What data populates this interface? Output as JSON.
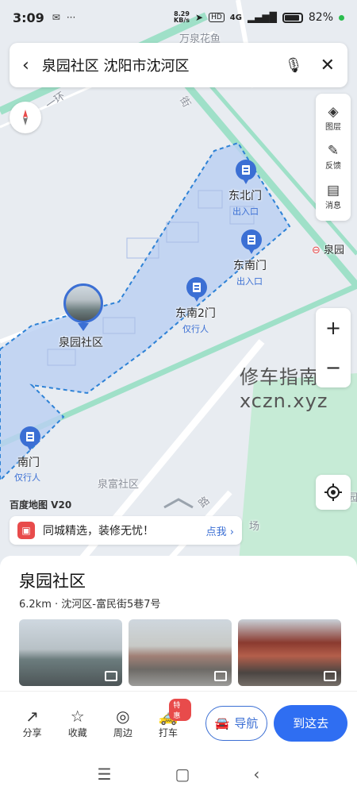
{
  "status_bar": {
    "time": "3:09",
    "net_speed_value": "8.29",
    "net_speed_unit": "KB/s",
    "signal": "4G",
    "battery_percent": "82%",
    "battery_level": 0.82
  },
  "search": {
    "query": "泉园社区 沈阳市沈河区"
  },
  "side_tools": [
    {
      "label": "图层",
      "icon": "layers-icon"
    },
    {
      "label": "反馈",
      "icon": "feedback-icon"
    },
    {
      "label": "消息",
      "icon": "message-icon"
    }
  ],
  "zoom": {
    "in": "+",
    "out": "−"
  },
  "map_labels": {
    "top_poi": "万泉花鱼",
    "road_ring": "一环",
    "road_jie": "街",
    "gate_ne": "东北门",
    "gate_ne_sub": "出入口",
    "gate_se": "东南门",
    "gate_se_sub": "出入口",
    "gate_se2": "东南2门",
    "gate_se2_sub": "仅行人",
    "community": "泉园社区",
    "gate_s": "南门",
    "gate_s_sub": "仅行人",
    "quanfu": "泉富社区",
    "quanyuan_station": "泉园",
    "road_lu": "路",
    "plaza": "场",
    "edge_char": "园"
  },
  "watermark": {
    "line1": "修车指南",
    "line2": "xczn.xyz"
  },
  "brand": "百度地图 V20",
  "promo": {
    "text": "同城精选，装修无忧！",
    "action": "点我 ›"
  },
  "place": {
    "name": "泉园社区",
    "distance": "6.2km",
    "address": "沈河区-富民街5巷7号"
  },
  "toolbar": {
    "share": "分享",
    "favorite": "收藏",
    "nearby": "周边",
    "taxi": "打车",
    "taxi_badge": "特惠",
    "navigate": "导航",
    "go_here": "到这去"
  },
  "colors": {
    "accent": "#2f6ef2",
    "area_fill": "#b9cff3",
    "area_border": "#2e82d6",
    "road_green": "#9fe0c8"
  }
}
